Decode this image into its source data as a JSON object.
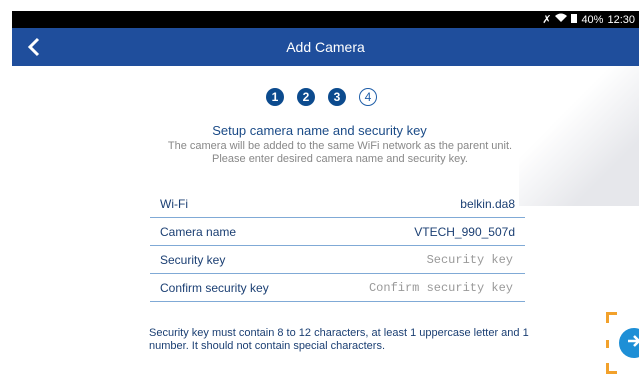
{
  "status": {
    "battery": "40%",
    "time": "12:30"
  },
  "appbar": {
    "title": "Add Camera"
  },
  "steps": [
    "1",
    "2",
    "3",
    "4"
  ],
  "heading": "Setup camera name and security key",
  "subtitle_lines": [
    "The camera will be added to the same WiFi network as the parent unit.",
    "Please enter desired camera name and security key."
  ],
  "form": {
    "wifi": {
      "label": "Wi-Fi",
      "value": "belkin.da8"
    },
    "camera_name": {
      "label": "Camera name",
      "value": "VTECH_990_507d"
    },
    "security_key": {
      "label": "Security key",
      "placeholder": "Security key"
    },
    "confirm_key": {
      "label": "Confirm security key",
      "placeholder": "Confirm security key"
    }
  },
  "note": "Security key must contain 8 to 12 characters, at least 1 uppercase letter and 1 number. It should not contain special characters.",
  "icons": {
    "back": "back-arrow-icon",
    "next": "next-arrow-icon",
    "wifi": "wifi-icon",
    "battery": "battery-icon",
    "mute": "mute-icon"
  },
  "colors": {
    "appbar": "#1f4e9c",
    "step_filled": "#0c4b8e",
    "divider": "#80aad6",
    "next_button": "#1e8fd6",
    "focus_bracket": "#f2a12b"
  }
}
